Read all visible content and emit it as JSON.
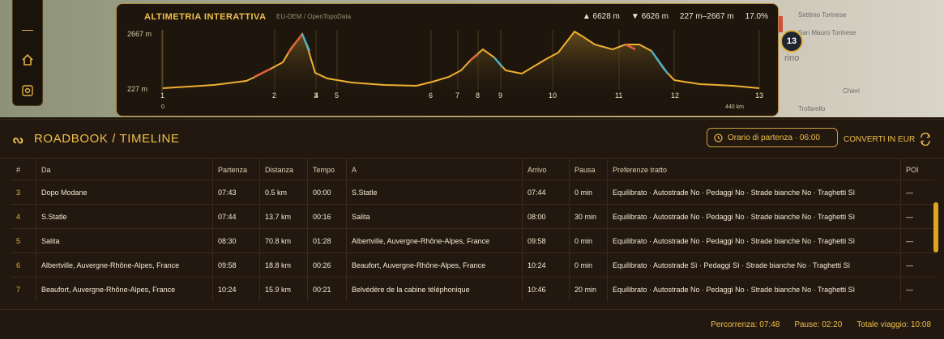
{
  "map": {
    "cities": [
      "Settimo Torinese",
      "San Mauro Torinese",
      "rino",
      "Chieri",
      "Trofarello"
    ],
    "waypoint_badge": "13",
    "controls": [
      "minus-icon",
      "home-icon",
      "locate-icon"
    ]
  },
  "altimetry": {
    "title": "ALTIMETRIA INTERATTIVA",
    "source": "EU-DEM / OpenTopoData",
    "ascent": "6628 m",
    "descent": "6626 m",
    "range": "227 m–2667 m",
    "grade": "17.0%",
    "y_max_label": "2667 m",
    "y_min_label": "227 m",
    "x_start_label": "0",
    "x_end_label": "440 km",
    "waypoints": [
      "1",
      "2",
      "3",
      "4",
      "5",
      "6",
      "7",
      "8",
      "9",
      "10",
      "11",
      "12",
      "13"
    ]
  },
  "roadbook": {
    "title": "ROADBOOK / TIMELINE",
    "departure_label": "Orario di partenza · 06:00",
    "convert_label": "CONVERTI IN EUR",
    "columns": [
      "#",
      "Da",
      "Partenza",
      "Distanza",
      "Tempo",
      "A",
      "Arrivo",
      "Pausa",
      "Preferenze tratto",
      "POI"
    ],
    "rows": [
      [
        "3",
        "Dopo Modane",
        "07:43",
        "0.5 km",
        "00:00",
        "S.Statle",
        "07:44",
        "0 min",
        "Equilibrato · Autostrade No · Pedaggi No · Strade bianche No · Traghetti Sì",
        "—"
      ],
      [
        "4",
        "S.Statle",
        "07:44",
        "13.7 km",
        "00:16",
        "Salita",
        "08:00",
        "30 min",
        "Equilibrato · Autostrade No · Pedaggi No · Strade bianche No · Traghetti Sì",
        "—"
      ],
      [
        "5",
        "Salita",
        "08:30",
        "70.8 km",
        "01:28",
        "Albertville, Auvergne-Rhône-Alpes, France",
        "09:58",
        "0 min",
        "Equilibrato · Autostrade No · Pedaggi No · Strade bianche No · Traghetti Sì",
        "—"
      ],
      [
        "6",
        "Albertville, Auvergne-Rhône-Alpes, France",
        "09:58",
        "18.8 km",
        "00:26",
        "Beaufort, Auvergne-Rhône-Alpes, France",
        "10:24",
        "0 min",
        "Equilibrato · Autostrade Sì · Pedaggi Sì · Strade bianche No · Traghetti Sì",
        "—"
      ],
      [
        "7",
        "Beaufort, Auvergne-Rhône-Alpes, France",
        "10:24",
        "15.9 km",
        "00:21",
        "Belvédère de la cabine téléphonique",
        "10:46",
        "20 min",
        "Equilibrato · Autostrade No · Pedaggi No · Strade bianche No · Traghetti Sì",
        "—"
      ]
    ],
    "footer": {
      "travel": "Percorrenza: 07:48",
      "pauses": "Pause: 02:20",
      "total": "Totale viaggio: 10:08"
    }
  },
  "colors": {
    "accent": "#f0c04a",
    "climb": "#e0603a",
    "descent": "#4ab0c8"
  }
}
